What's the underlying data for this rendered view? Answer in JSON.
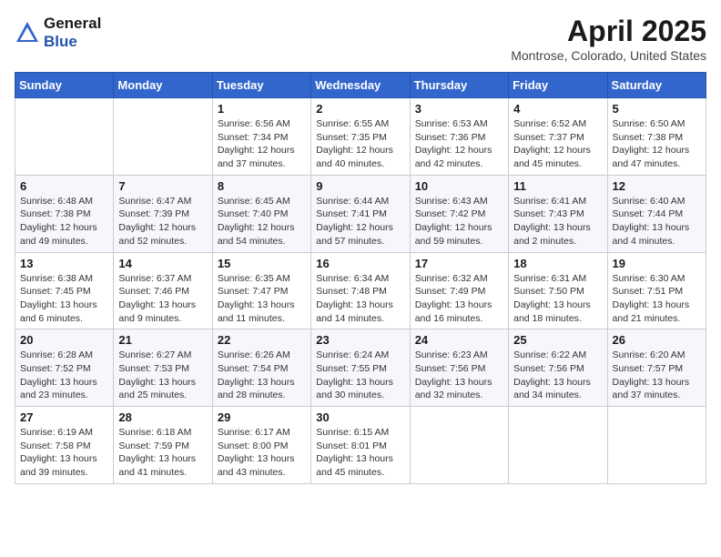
{
  "logo": {
    "general": "General",
    "blue": "Blue"
  },
  "header": {
    "month": "April 2025",
    "location": "Montrose, Colorado, United States"
  },
  "weekdays": [
    "Sunday",
    "Monday",
    "Tuesday",
    "Wednesday",
    "Thursday",
    "Friday",
    "Saturday"
  ],
  "weeks": [
    [
      {
        "day": "",
        "info": ""
      },
      {
        "day": "",
        "info": ""
      },
      {
        "day": "1",
        "info": "Sunrise: 6:56 AM\nSunset: 7:34 PM\nDaylight: 12 hours and 37 minutes."
      },
      {
        "day": "2",
        "info": "Sunrise: 6:55 AM\nSunset: 7:35 PM\nDaylight: 12 hours and 40 minutes."
      },
      {
        "day": "3",
        "info": "Sunrise: 6:53 AM\nSunset: 7:36 PM\nDaylight: 12 hours and 42 minutes."
      },
      {
        "day": "4",
        "info": "Sunrise: 6:52 AM\nSunset: 7:37 PM\nDaylight: 12 hours and 45 minutes."
      },
      {
        "day": "5",
        "info": "Sunrise: 6:50 AM\nSunset: 7:38 PM\nDaylight: 12 hours and 47 minutes."
      }
    ],
    [
      {
        "day": "6",
        "info": "Sunrise: 6:48 AM\nSunset: 7:38 PM\nDaylight: 12 hours and 49 minutes."
      },
      {
        "day": "7",
        "info": "Sunrise: 6:47 AM\nSunset: 7:39 PM\nDaylight: 12 hours and 52 minutes."
      },
      {
        "day": "8",
        "info": "Sunrise: 6:45 AM\nSunset: 7:40 PM\nDaylight: 12 hours and 54 minutes."
      },
      {
        "day": "9",
        "info": "Sunrise: 6:44 AM\nSunset: 7:41 PM\nDaylight: 12 hours and 57 minutes."
      },
      {
        "day": "10",
        "info": "Sunrise: 6:43 AM\nSunset: 7:42 PM\nDaylight: 12 hours and 59 minutes."
      },
      {
        "day": "11",
        "info": "Sunrise: 6:41 AM\nSunset: 7:43 PM\nDaylight: 13 hours and 2 minutes."
      },
      {
        "day": "12",
        "info": "Sunrise: 6:40 AM\nSunset: 7:44 PM\nDaylight: 13 hours and 4 minutes."
      }
    ],
    [
      {
        "day": "13",
        "info": "Sunrise: 6:38 AM\nSunset: 7:45 PM\nDaylight: 13 hours and 6 minutes."
      },
      {
        "day": "14",
        "info": "Sunrise: 6:37 AM\nSunset: 7:46 PM\nDaylight: 13 hours and 9 minutes."
      },
      {
        "day": "15",
        "info": "Sunrise: 6:35 AM\nSunset: 7:47 PM\nDaylight: 13 hours and 11 minutes."
      },
      {
        "day": "16",
        "info": "Sunrise: 6:34 AM\nSunset: 7:48 PM\nDaylight: 13 hours and 14 minutes."
      },
      {
        "day": "17",
        "info": "Sunrise: 6:32 AM\nSunset: 7:49 PM\nDaylight: 13 hours and 16 minutes."
      },
      {
        "day": "18",
        "info": "Sunrise: 6:31 AM\nSunset: 7:50 PM\nDaylight: 13 hours and 18 minutes."
      },
      {
        "day": "19",
        "info": "Sunrise: 6:30 AM\nSunset: 7:51 PM\nDaylight: 13 hours and 21 minutes."
      }
    ],
    [
      {
        "day": "20",
        "info": "Sunrise: 6:28 AM\nSunset: 7:52 PM\nDaylight: 13 hours and 23 minutes."
      },
      {
        "day": "21",
        "info": "Sunrise: 6:27 AM\nSunset: 7:53 PM\nDaylight: 13 hours and 25 minutes."
      },
      {
        "day": "22",
        "info": "Sunrise: 6:26 AM\nSunset: 7:54 PM\nDaylight: 13 hours and 28 minutes."
      },
      {
        "day": "23",
        "info": "Sunrise: 6:24 AM\nSunset: 7:55 PM\nDaylight: 13 hours and 30 minutes."
      },
      {
        "day": "24",
        "info": "Sunrise: 6:23 AM\nSunset: 7:56 PM\nDaylight: 13 hours and 32 minutes."
      },
      {
        "day": "25",
        "info": "Sunrise: 6:22 AM\nSunset: 7:56 PM\nDaylight: 13 hours and 34 minutes."
      },
      {
        "day": "26",
        "info": "Sunrise: 6:20 AM\nSunset: 7:57 PM\nDaylight: 13 hours and 37 minutes."
      }
    ],
    [
      {
        "day": "27",
        "info": "Sunrise: 6:19 AM\nSunset: 7:58 PM\nDaylight: 13 hours and 39 minutes."
      },
      {
        "day": "28",
        "info": "Sunrise: 6:18 AM\nSunset: 7:59 PM\nDaylight: 13 hours and 41 minutes."
      },
      {
        "day": "29",
        "info": "Sunrise: 6:17 AM\nSunset: 8:00 PM\nDaylight: 13 hours and 43 minutes."
      },
      {
        "day": "30",
        "info": "Sunrise: 6:15 AM\nSunset: 8:01 PM\nDaylight: 13 hours and 45 minutes."
      },
      {
        "day": "",
        "info": ""
      },
      {
        "day": "",
        "info": ""
      },
      {
        "day": "",
        "info": ""
      }
    ]
  ]
}
